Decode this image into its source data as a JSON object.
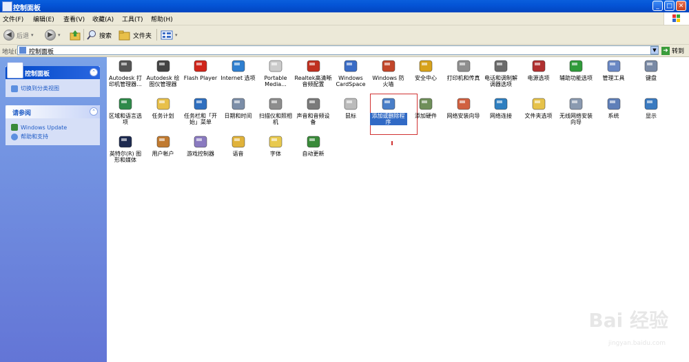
{
  "window": {
    "title": "控制面板"
  },
  "menu": [
    "文件(F)",
    "编辑(E)",
    "查看(V)",
    "收藏(A)",
    "工具(T)",
    "帮助(H)"
  ],
  "toolbar": {
    "back": "后退",
    "search": "搜索",
    "folders": "文件夹"
  },
  "address": {
    "label": "地址(D)",
    "value": "控制面板",
    "go": "转到"
  },
  "sidebar": {
    "panel1": {
      "title": "控制面板",
      "links": [
        "切换到分类视图"
      ]
    },
    "panel2": {
      "title": "请参阅",
      "links": [
        "Windows Update",
        "帮助和支持"
      ]
    }
  },
  "items": [
    {
      "label": "Autodesk 打印机管理器...",
      "icon": "printer-icon",
      "color": "#555555"
    },
    {
      "label": "Autodesk 绘图仪管理器",
      "icon": "plotter-icon",
      "color": "#444444"
    },
    {
      "label": "Flash Player",
      "icon": "flash-icon",
      "color": "#d0241a"
    },
    {
      "label": "Internet 选项",
      "icon": "internet-options-icon",
      "color": "#2f7fd0"
    },
    {
      "label": "Portable Media...",
      "icon": "portable-media-icon",
      "color": "#cccccc"
    },
    {
      "label": "Realtek高清晰音频配置",
      "icon": "speaker-icon",
      "color": "#c03020"
    },
    {
      "label": "Windows CardSpace",
      "icon": "cardspace-icon",
      "color": "#3a6cc6"
    },
    {
      "label": "Windows 防火墙",
      "icon": "firewall-icon",
      "color": "#c2462a"
    },
    {
      "label": "安全中心",
      "icon": "security-shield-icon",
      "color": "#d7a21b"
    },
    {
      "label": "打印机和传真",
      "icon": "printer-fax-icon",
      "color": "#8f8f8f"
    },
    {
      "label": "电话和调制解调器选项",
      "icon": "phone-modem-icon",
      "color": "#6b6b6b"
    },
    {
      "label": "电源选项",
      "icon": "power-icon",
      "color": "#b03030"
    },
    {
      "label": "辅助功能选项",
      "icon": "accessibility-icon",
      "color": "#2f9b3a"
    },
    {
      "label": "管理工具",
      "icon": "admin-tools-icon",
      "color": "#6a88c4"
    },
    {
      "label": "键盘",
      "icon": "keyboard-icon",
      "color": "#7a8aa5"
    },
    {
      "label": "区域和语言选项",
      "icon": "globe-icon",
      "color": "#2f8a4a"
    },
    {
      "label": "任务计划",
      "icon": "scheduled-tasks-icon",
      "color": "#e8c04a"
    },
    {
      "label": "任务栏和「开始」菜单",
      "icon": "taskbar-icon",
      "color": "#2f6fbf"
    },
    {
      "label": "日期和时间",
      "icon": "clock-icon",
      "color": "#7c8ea8"
    },
    {
      "label": "扫描仪和照相机",
      "icon": "scanner-icon",
      "color": "#8d8d8d"
    },
    {
      "label": "声音和音频设备",
      "icon": "sound-icon",
      "color": "#7a7a7a"
    },
    {
      "label": "鼠标",
      "icon": "mouse-icon",
      "color": "#bbbbbb"
    },
    {
      "label": "添加或删除程序",
      "icon": "add-remove-programs-icon",
      "color": "#4a7fc8"
    },
    {
      "label": "添加硬件",
      "icon": "add-hardware-icon",
      "color": "#6f8f5a"
    },
    {
      "label": "网络安装向导",
      "icon": "network-setup-icon",
      "color": "#d06040"
    },
    {
      "label": "网络连接",
      "icon": "network-connections-icon",
      "color": "#2f7fc0"
    },
    {
      "label": "文件夹选项",
      "icon": "folder-options-icon",
      "color": "#e6c24a"
    },
    {
      "label": "无线网络安装向导",
      "icon": "wireless-icon",
      "color": "#8a9ab0"
    },
    {
      "label": "系统",
      "icon": "system-icon",
      "color": "#5f7fb8"
    },
    {
      "label": "显示",
      "icon": "display-icon",
      "color": "#3a7ac0"
    },
    {
      "label": "英特尔(R) 图形和媒体",
      "icon": "intel-graphics-icon",
      "color": "#1d2a50"
    },
    {
      "label": "用户帐户",
      "icon": "user-accounts-icon",
      "color": "#c07a30"
    },
    {
      "label": "游戏控制器",
      "icon": "game-controller-icon",
      "color": "#8a7ac0"
    },
    {
      "label": "语音",
      "icon": "speech-icon",
      "color": "#e0b23a"
    },
    {
      "label": "字体",
      "icon": "fonts-icon",
      "color": "#e8c94e"
    },
    {
      "label": "自动更新",
      "icon": "auto-update-icon",
      "color": "#3a8a3a"
    }
  ],
  "watermark": {
    "brand": "Bai 经验",
    "url": "jingyan.baidu.com"
  }
}
